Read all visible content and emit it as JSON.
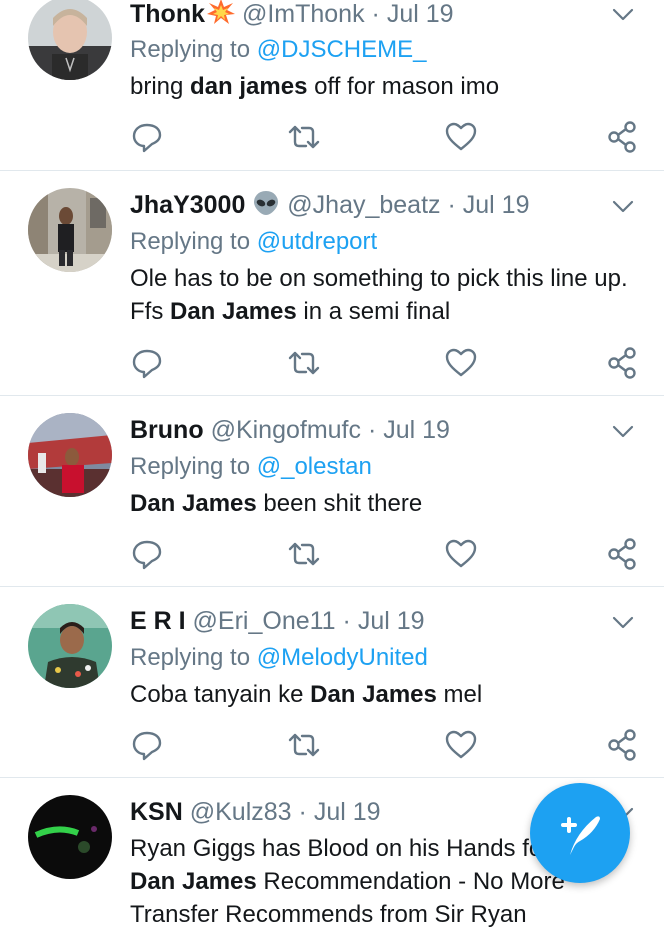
{
  "tweets": [
    {
      "name": "Thonk",
      "name_emoji": "collision-emoji",
      "handle": "@ImThonk",
      "sep": "·",
      "date": "Jul 19",
      "reply_prefix": "Replying to ",
      "reply_to": "@DJSCHEME_",
      "text_parts": [
        {
          "t": "bring ",
          "b": false
        },
        {
          "t": "dan james",
          "b": true
        },
        {
          "t": " off for mason imo",
          "b": false
        }
      ]
    },
    {
      "name": "JhaY3000",
      "name_emoji": "alien-emoji",
      "handle": "@Jhay_beatz",
      "sep": "·",
      "date": "Jul 19",
      "reply_prefix": "Replying to ",
      "reply_to": "@utdreport",
      "text_parts": [
        {
          "t": "Ole has to be on something to pick this line up. Ffs ",
          "b": false
        },
        {
          "t": "Dan James",
          "b": true
        },
        {
          "t": " in a semi final",
          "b": false
        }
      ]
    },
    {
      "name": "Bruno",
      "handle": "@Kingofmufc",
      "sep": "·",
      "date": "Jul 19",
      "reply_prefix": "Replying to ",
      "reply_to": "@_olestan",
      "text_parts": [
        {
          "t": "Dan James",
          "b": true
        },
        {
          "t": " been shit there",
          "b": false
        }
      ]
    },
    {
      "name": "E R I",
      "handle": "@Eri_One11",
      "sep": "·",
      "date": "Jul 19",
      "reply_prefix": "Replying to ",
      "reply_to": "@MelodyUnited",
      "text_parts": [
        {
          "t": "Coba tanyain ke ",
          "b": false
        },
        {
          "t": "Dan James",
          "b": true
        },
        {
          "t": " mel",
          "b": false
        }
      ]
    },
    {
      "name": "KSN",
      "handle": "@Kulz83",
      "sep": "·",
      "date": "Jul 19",
      "text_parts": [
        {
          "t": "Ryan Giggs has Blood on his Hands for that ",
          "b": false
        },
        {
          "t": "Dan James",
          "b": true
        },
        {
          "t": " Recommendation - No More Transfer Recommends from Sir Ryan",
          "b": false
        }
      ]
    }
  ],
  "icons": {
    "reply": "reply-icon",
    "retweet": "retweet-icon",
    "like": "like-icon",
    "share": "share-icon",
    "more": "chevron-down-icon",
    "compose": "compose-tweet-icon"
  },
  "colors": {
    "accent": "#1da1f2",
    "text": "#14171a",
    "secondary": "#657786",
    "icon": "#657786",
    "divider": "#e1e8ed"
  }
}
